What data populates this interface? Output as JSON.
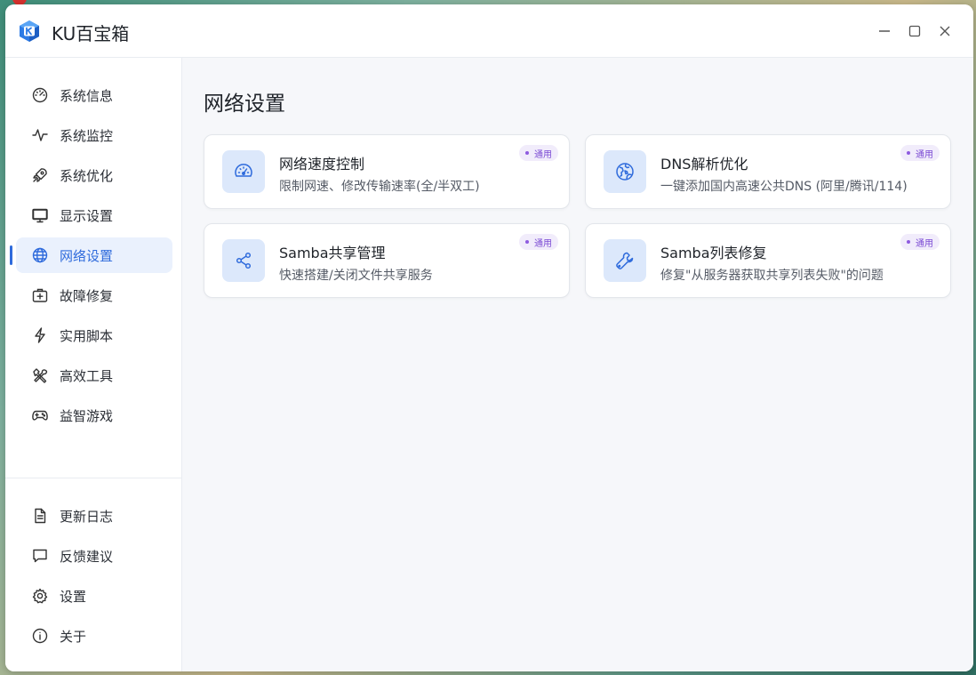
{
  "window": {
    "title": "KU百宝箱",
    "controls": {
      "minimize": "minimize",
      "maximize": "maximize",
      "close": "close"
    }
  },
  "sidebar": {
    "items": [
      {
        "label": "系统信息",
        "icon": "dashboard-gauge-icon",
        "active": false
      },
      {
        "label": "系统监控",
        "icon": "pulse-icon",
        "active": false
      },
      {
        "label": "系统优化",
        "icon": "rocket-icon",
        "active": false
      },
      {
        "label": "显示设置",
        "icon": "monitor-icon",
        "active": false
      },
      {
        "label": "网络设置",
        "icon": "globe-icon",
        "active": true
      },
      {
        "label": "故障修复",
        "icon": "first-aid-kit-icon",
        "active": false
      },
      {
        "label": "实用脚本",
        "icon": "lightning-icon",
        "active": false
      },
      {
        "label": "高效工具",
        "icon": "tools-icon",
        "active": false
      },
      {
        "label": "益智游戏",
        "icon": "gamepad-icon",
        "active": false
      }
    ],
    "bottom_items": [
      {
        "label": "更新日志",
        "icon": "document-icon"
      },
      {
        "label": "反馈建议",
        "icon": "chat-bubble-icon"
      },
      {
        "label": "设置",
        "icon": "gear-icon"
      },
      {
        "label": "关于",
        "icon": "info-icon"
      }
    ]
  },
  "main": {
    "page_title": "网络设置",
    "cards": [
      {
        "title": "网络速度控制",
        "desc": "限制网速、修改传输速率(全/半双工)",
        "tag": "通用",
        "icon": "speedometer-icon"
      },
      {
        "title": "DNS解析优化",
        "desc": "一键添加国内高速公共DNS (阿里/腾讯/114)",
        "tag": "通用",
        "icon": "globe-icon"
      },
      {
        "title": "Samba共享管理",
        "desc": "快速搭建/关闭文件共享服务",
        "tag": "通用",
        "icon": "share-icon"
      },
      {
        "title": "Samba列表修复",
        "desc": "修复\"从服务器获取共享列表失败\"的问题",
        "tag": "通用",
        "icon": "wrench-icon"
      }
    ]
  },
  "colors": {
    "accent": "#2f6bdc",
    "active_bg": "#eaf1fd",
    "icon_box_bg": "#dce8fb",
    "tag_text": "#7b4bd4",
    "tag_bg": "#f1ecfb"
  }
}
